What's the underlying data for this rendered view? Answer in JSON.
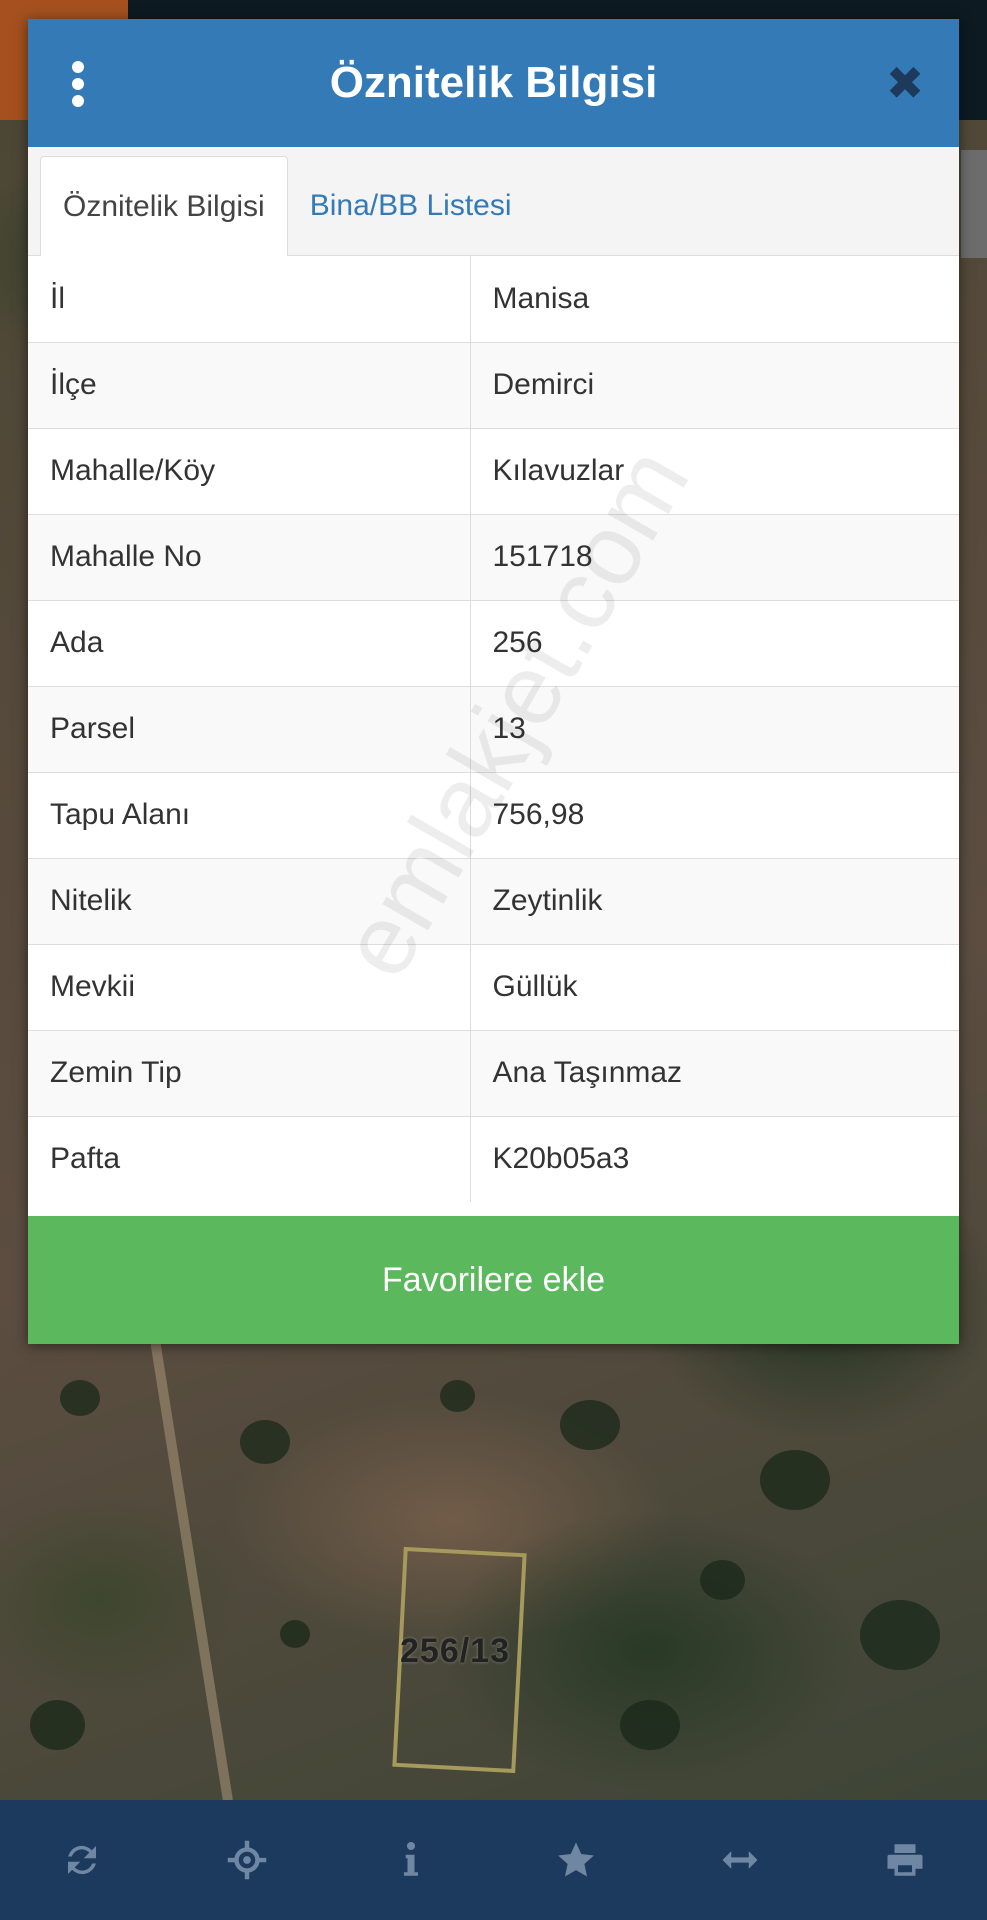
{
  "dialog": {
    "title": "Öznitelik Bilgisi",
    "tabs": [
      {
        "label": "Öznitelik Bilgisi",
        "active": true
      },
      {
        "label": "Bina/BB Listesi",
        "active": false
      }
    ],
    "rows": [
      {
        "key": "İl",
        "value": "Manisa"
      },
      {
        "key": "İlçe",
        "value": "Demirci"
      },
      {
        "key": "Mahalle/Köy",
        "value": "Kılavuzlar"
      },
      {
        "key": "Mahalle No",
        "value": "151718"
      },
      {
        "key": "Ada",
        "value": "256"
      },
      {
        "key": "Parsel",
        "value": "13"
      },
      {
        "key": "Tapu Alanı",
        "value": "756,98"
      },
      {
        "key": "Nitelik",
        "value": "Zeytinlik"
      },
      {
        "key": "Mevkii",
        "value": "Güllük"
      },
      {
        "key": "Zemin Tip",
        "value": "Ana Taşınmaz"
      },
      {
        "key": "Pafta",
        "value": "K20b05a3"
      }
    ],
    "favorite_label": "Favorilere ekle"
  },
  "map": {
    "parcel_label": "256/13"
  },
  "watermark": "emlakjet.com",
  "toolbar": {
    "icons": [
      "refresh-icon",
      "locate-icon",
      "info-icon",
      "star-icon",
      "measure-icon",
      "print-icon"
    ]
  },
  "colors": {
    "header": "#337ab7",
    "favorite": "#5cb85c",
    "toolbar": "#1c3a5e",
    "toolbar_icon": "#6f87a3"
  }
}
